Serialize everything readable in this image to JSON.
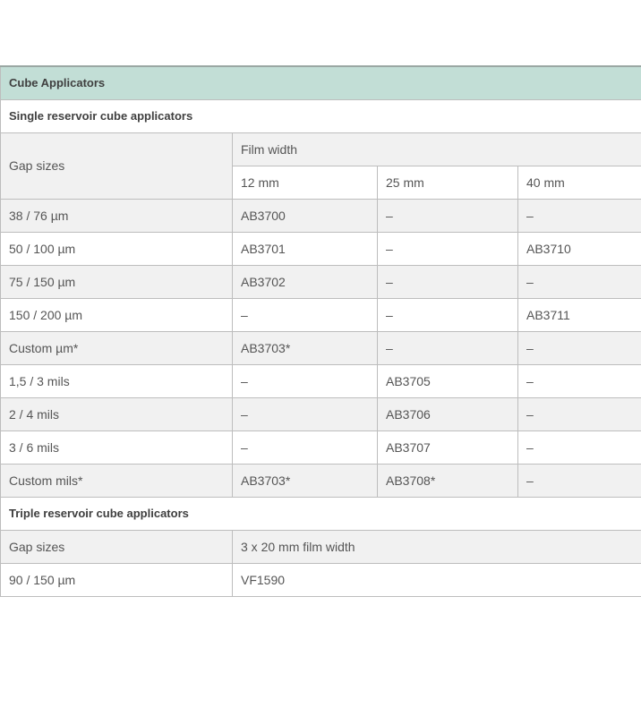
{
  "table": {
    "title": "Cube Applicators",
    "single_section": "Single reservoir cube applicators",
    "gap_sizes_label": "Gap sizes",
    "film_width_label": "Film width",
    "widths": [
      "12 mm",
      "25 mm",
      "40 mm"
    ],
    "rows": [
      [
        "38 / 76 µm",
        "AB3700",
        "–",
        "–"
      ],
      [
        "50 / 100 µm",
        "AB3701",
        "–",
        "AB3710"
      ],
      [
        "75 / 150 µm",
        "AB3702",
        "–",
        "–"
      ],
      [
        "150 / 200 µm",
        "–",
        "–",
        "AB3711"
      ],
      [
        "Custom µm*",
        "AB3703*",
        "–",
        "–"
      ],
      [
        "1,5 / 3 mils",
        "–",
        "AB3705",
        "–"
      ],
      [
        "2 / 4 mils",
        "–",
        "AB3706",
        "–"
      ],
      [
        "3 / 6 mils",
        "–",
        "AB3707",
        "–"
      ],
      [
        "Custom mils*",
        "AB3703*",
        "AB3708*",
        "–"
      ]
    ],
    "triple_section": "Triple reservoir cube applicators",
    "triple_gap_label": "Gap sizes",
    "triple_width_label": "3 x 20 mm film width",
    "triple_rows": [
      [
        "90 / 150 µm",
        "VF1590"
      ]
    ]
  }
}
